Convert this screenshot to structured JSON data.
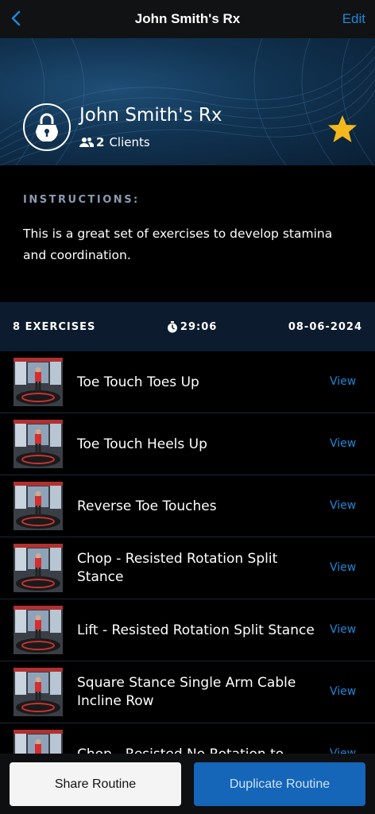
{
  "nav": {
    "title": "John Smith's Rx",
    "edit_label": "Edit"
  },
  "header": {
    "routine_name": "John Smith's Rx",
    "clients_count": "2",
    "clients_label": "Clients",
    "favorite": true
  },
  "instructions": {
    "label": "INSTRUCTIONS:",
    "text": "This is a great set of exercises to develop stamina and coordination."
  },
  "stats": {
    "exercises": "8 EXERCISES",
    "duration": "29:06",
    "date": "08-06-2024"
  },
  "exercises": [
    {
      "name": "Toe Touch Toes Up",
      "view": "View"
    },
    {
      "name": "Toe Touch Heels Up",
      "view": "View"
    },
    {
      "name": "Reverse Toe Touches",
      "view": "View"
    },
    {
      "name": "Chop - Resisted Rotation Split Stance",
      "view": "View"
    },
    {
      "name": "Lift - Resisted Rotation Split Stance",
      "view": "View"
    },
    {
      "name": "Square Stance Single Arm Cable Incline Row",
      "view": "View"
    },
    {
      "name": "Chop - Resisted No Rotation to",
      "view": "View"
    }
  ],
  "buttons": {
    "share": "Share Routine",
    "duplicate": "Duplicate Routine"
  },
  "colors": {
    "accent": "#1e88d8",
    "star": "#f5b81c",
    "button_primary": "#1565b8"
  }
}
